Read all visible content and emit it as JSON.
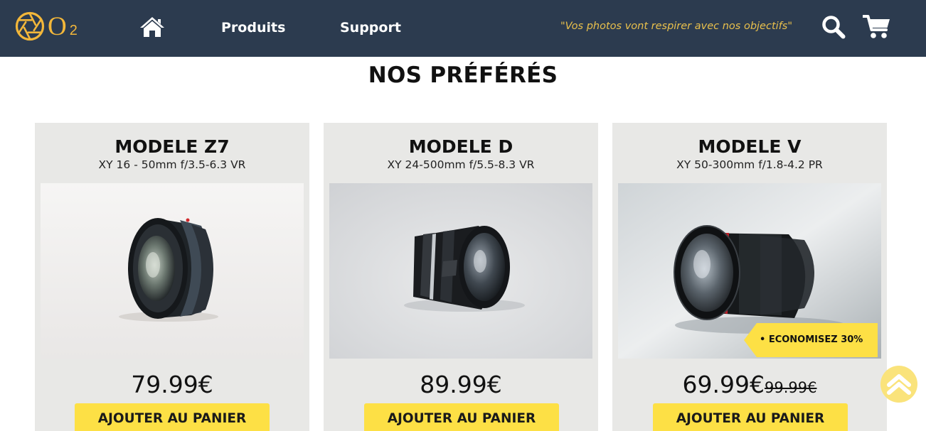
{
  "header": {
    "logo_text": "O",
    "logo_subscript": "2",
    "nav": [
      {
        "label": "Produits"
      },
      {
        "label": "Support"
      }
    ],
    "tagline": "\"Vos photos vont respirer avec nos objectifs\"",
    "icons": [
      "home-icon",
      "search-icon",
      "cart-icon"
    ],
    "colors": {
      "bar": "#2c3b4f",
      "accent": "#f3b73a",
      "tagline": "#e9c04c"
    }
  },
  "section": {
    "title": "NOS PRÉFÉRÉS"
  },
  "products": [
    {
      "name": "MODELE Z7",
      "spec": "XY 16 - 50mm f/3.5-6.3 VR",
      "price": "79.99€",
      "old_price": "",
      "button": "AJOUTER AU PANIER"
    },
    {
      "name": "MODELE D",
      "spec": "XY 24-500mm f/5.5-8.3 VR",
      "price": "89.99€",
      "old_price": "",
      "button": "AJOUTER AU PANIER"
    },
    {
      "name": "MODELE V",
      "spec": "XY 50-300mm f/1.8-4.2 PR",
      "price": "69.99€",
      "old_price": "99.99€",
      "button": "AJOUTER AU PANIER",
      "badge": "• ECONOMISEZ 30%"
    }
  ],
  "colors": {
    "button": "#fde045",
    "card": "#e8e8e6",
    "back_to_top": "#fae37b"
  },
  "back_to_top_icon": "chevron-up-icon"
}
